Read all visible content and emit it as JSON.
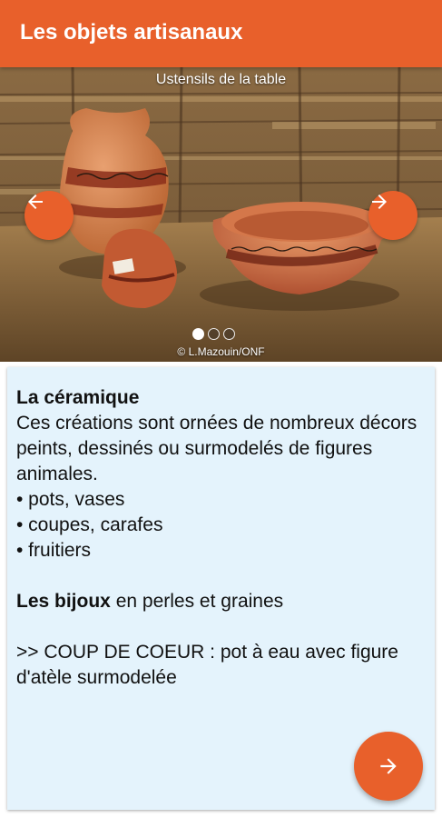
{
  "app_bar": {
    "title": "Les objets artisanaux",
    "accent": "#E8602B"
  },
  "carousel": {
    "caption": "Ustensils de la table",
    "credit": "© L.Mazouin/ONF",
    "prev_icon": "arrow-left-icon",
    "next_icon": "arrow-right-icon",
    "page_count": 3,
    "active_index": 0
  },
  "content": {
    "ceramique_title": "La céramique",
    "ceramique_text": "Ces créations sont ornées de nombreux décors peints, dessinés ou surmodelés de figures animales.",
    "bullets": [
      "• pots, vases",
      "• coupes, carafes",
      "• fruitiers"
    ],
    "bijoux_bold": "Les bijoux",
    "bijoux_rest": " en perles et graines",
    "coup_de_coeur": ">> COUP DE COEUR : pot à eau avec figure d'atèle surmodelée"
  },
  "fab": {
    "icon": "arrow-right-icon"
  },
  "colors": {
    "card_background": "#E4F3FC"
  }
}
